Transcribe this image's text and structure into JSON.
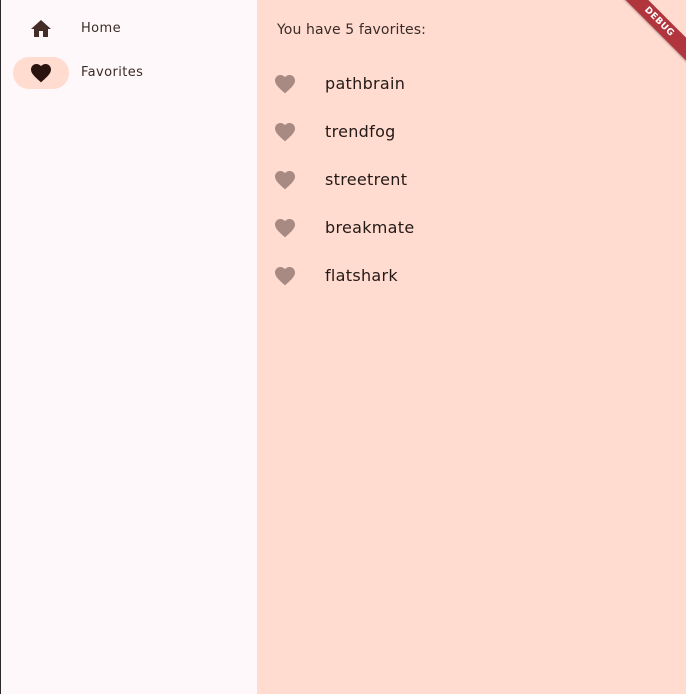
{
  "nav": {
    "items": [
      {
        "label": "Home",
        "icon": "home-icon",
        "selected": false
      },
      {
        "label": "Favorites",
        "icon": "favorite-icon",
        "selected": true
      }
    ]
  },
  "favorites": {
    "header": "You have 5 favorites:",
    "items": [
      {
        "name": "pathbrain",
        "icon": "favorite-icon"
      },
      {
        "name": "trendfog",
        "icon": "favorite-icon"
      },
      {
        "name": "streetrent",
        "icon": "favorite-icon"
      },
      {
        "name": "breakmate",
        "icon": "favorite-icon"
      },
      {
        "name": "flatshark",
        "icon": "favorite-icon"
      }
    ]
  },
  "debug_banner": {
    "label": "DEBUG"
  },
  "colors": {
    "content_background": "#ffdbd0",
    "rail_background": "#fff8fa",
    "indicator": "#ffdbd0",
    "list_icon": "#a88a82",
    "nav_icon": "#442d29",
    "debug_ribbon": "#b0353d"
  }
}
